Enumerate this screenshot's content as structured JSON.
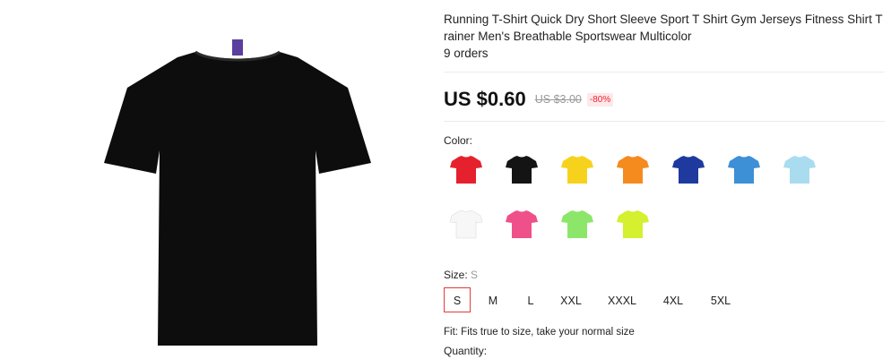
{
  "product": {
    "title": "Running T-Shirt Quick Dry Short Sleeve Sport T Shirt Gym Jerseys Fitness Shirt Trainer Men's Breathable Sportswear Multicolor",
    "orders": "9 orders",
    "main_image_icon": "black-tshirt-image",
    "main_image_color": "#0d0d0d"
  },
  "price": {
    "current": "US $0.60",
    "original": "US $3.00",
    "discount": "-80%"
  },
  "color": {
    "label": "Color:",
    "swatches": [
      {
        "icon": "red-tshirt-icon",
        "hex": "#e5212e"
      },
      {
        "icon": "black-tshirt-icon",
        "hex": "#141414"
      },
      {
        "icon": "yellow-tshirt-icon",
        "hex": "#f7d21c"
      },
      {
        "icon": "orange-tshirt-icon",
        "hex": "#f58a1f"
      },
      {
        "icon": "navy-tshirt-icon",
        "hex": "#1e3a9e"
      },
      {
        "icon": "blue-tshirt-icon",
        "hex": "#3d8fd6"
      },
      {
        "icon": "light-blue-tshirt-icon",
        "hex": "#a9dcef"
      },
      {
        "icon": "white-tshirt-icon",
        "hex": "#f7f7f7"
      },
      {
        "icon": "pink-tshirt-icon",
        "hex": "#f0508a"
      },
      {
        "icon": "green-tshirt-icon",
        "hex": "#8ce66a"
      },
      {
        "icon": "lime-tshirt-icon",
        "hex": "#d4f02e"
      }
    ]
  },
  "size": {
    "label": "Size:",
    "selected": "S",
    "options": [
      "S",
      "M",
      "L",
      "XXL",
      "XXXL",
      "4XL",
      "5XL"
    ],
    "selected_border_color": "#e23b3b"
  },
  "fit": "Fit: Fits true to size, take your normal size",
  "quantity_label": "Quantity:"
}
